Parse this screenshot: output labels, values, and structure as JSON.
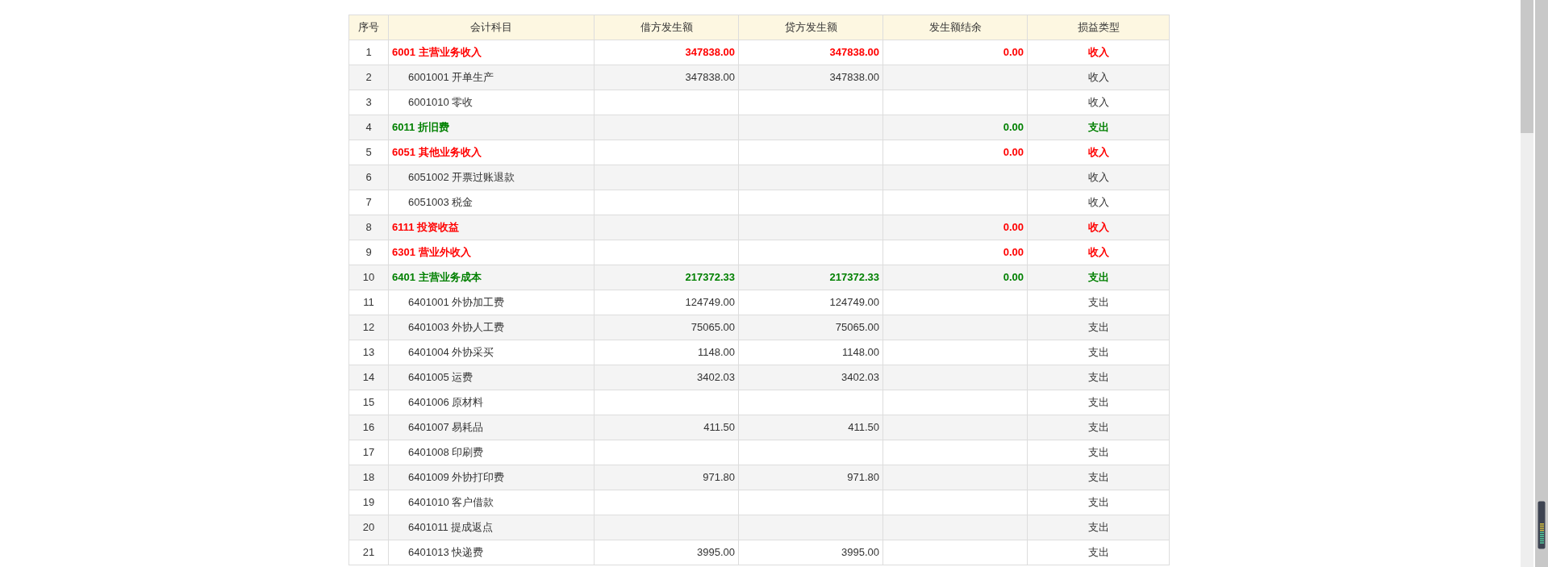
{
  "table": {
    "columns": [
      "序号",
      "会计科目",
      "借方发生额",
      "贷方发生额",
      "发生额结余",
      "损益类型"
    ],
    "rows": [
      {
        "seq": "1",
        "account": "6001 主营业务收入",
        "debit": "347838.00",
        "credit": "347838.00",
        "balance": "0.00",
        "type": "收入",
        "color": "#ff0000",
        "children": [
          {
            "seq": "2",
            "account": "6001001 开单生产",
            "debit": "347838.00",
            "credit": "347838.00",
            "type": "收入"
          },
          {
            "seq": "3",
            "account": "6001010 零收",
            "type": "收入"
          }
        ]
      },
      {
        "seq": "4",
        "account": "6011 折旧费",
        "balance": "0.00",
        "type": "支出",
        "color": "#008000"
      },
      {
        "seq": "5",
        "account": "6051 其他业务收入",
        "balance": "0.00",
        "type": "收入",
        "color": "#ff0000",
        "children": [
          {
            "seq": "6",
            "account": "6051002 开票过账退款",
            "type": "收入"
          },
          {
            "seq": "7",
            "account": "6051003 税金",
            "type": "收入"
          }
        ]
      },
      {
        "seq": "8",
        "account": "6111 投资收益",
        "balance": "0.00",
        "type": "收入",
        "color": "#ff0000"
      },
      {
        "seq": "9",
        "account": "6301 营业外收入",
        "balance": "0.00",
        "type": "收入",
        "color": "#ff0000"
      },
      {
        "seq": "10",
        "account": "6401 主营业务成本",
        "debit": "217372.33",
        "credit": "217372.33",
        "balance": "0.00",
        "type": "支出",
        "color": "#008000",
        "children": [
          {
            "seq": "11",
            "account": "6401001 外协加工费",
            "debit": "124749.00",
            "credit": "124749.00",
            "type": "支出"
          },
          {
            "seq": "12",
            "account": "6401003 外协人工费",
            "debit": "75065.00",
            "credit": "75065.00",
            "type": "支出"
          },
          {
            "seq": "13",
            "account": "6401004 外协采买",
            "debit": "1148.00",
            "credit": "1148.00",
            "type": "支出"
          },
          {
            "seq": "14",
            "account": "6401005 运费",
            "debit": "3402.03",
            "credit": "3402.03",
            "type": "支出"
          },
          {
            "seq": "15",
            "account": "6401006 原材料",
            "type": "支出"
          },
          {
            "seq": "16",
            "account": "6401007 易耗品",
            "debit": "411.50",
            "credit": "411.50",
            "type": "支出"
          },
          {
            "seq": "17",
            "account": "6401008 印刷费",
            "type": "支出"
          },
          {
            "seq": "18",
            "account": "6401009 外协打印费",
            "debit": "971.80",
            "credit": "971.80",
            "type": "支出"
          },
          {
            "seq": "19",
            "account": "6401010 客户借款",
            "type": "支出"
          },
          {
            "seq": "20",
            "account": "6401011 提成返点",
            "type": "支出"
          },
          {
            "seq": "21",
            "account": "6401013 快递费",
            "debit": "3995.00",
            "credit": "3995.00",
            "type": "支出"
          }
        ]
      }
    ]
  }
}
